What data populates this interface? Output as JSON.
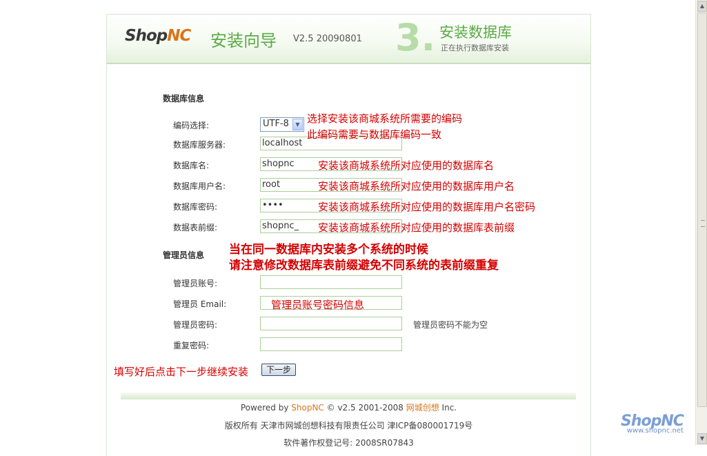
{
  "header": {
    "logo_shop": "Shop",
    "logo_nc": "NC",
    "wizard_title": "安装向导",
    "version": "V2.5 20090801",
    "step_number": "3.",
    "step_title": "安装数据库",
    "step_subtitle": "正在执行数据库安装"
  },
  "db_section": {
    "title": "数据库信息",
    "encoding_label": "编码选择:",
    "encoding_value": "UTF-8",
    "server_label": "数据库服务器:",
    "server_value": "localhost",
    "name_label": "数据库名:",
    "name_value": "shopnc",
    "user_label": "数据库用户名:",
    "user_value": "root",
    "password_label": "数据库密码:",
    "password_value": "••••",
    "prefix_label": "数据表前缀:",
    "prefix_value": "shopnc_"
  },
  "admin_section": {
    "title": "管理员信息",
    "account_label": "管理员账号:",
    "email_label": "管理员 Email:",
    "password_label": "管理员密码:",
    "repeat_label": "重复密码:",
    "password_hint": "管理员密码不能为空"
  },
  "annotations": {
    "encoding_1": "选择安装该商城系统所需要的编码",
    "encoding_2": "此编码需要与数据库编码一致",
    "db_name": "安装该商城系统所对应使用的数据库名",
    "db_user": "安装该商城系统所对应使用的数据库用户名",
    "db_password": "安装该商城系统所对应使用的数据库用户名密码",
    "db_prefix": "安装该商城系统所对应使用的数据库表前缀",
    "warning_1": "当在同一数据库内安装多个系统的时候",
    "warning_2": "请注意修改数据库表前缀避免不同系统的表前缀重复",
    "admin": "管理员账号密码信息",
    "next_step": "填写好后点击下一步继续安装"
  },
  "next_button_label": "下一步",
  "footer": {
    "powered_prefix": "Powered by",
    "powered_brand": "ShopNC",
    "powered_mid": "© v2.5 2001-2008",
    "powered_company": "网城创想",
    "powered_suffix": "Inc.",
    "copyright": "版权所有  天津市网城创想科技有限责任公司  津ICP备080001719号",
    "software_reg": "软件著作权登记号: 2008SR07843"
  },
  "watermark": {
    "brand": "ShopNC",
    "url": "www.shopnc.net"
  },
  "colors": {
    "accent_green": "#5aaa46",
    "annotation_red": "#d40000",
    "brand_orange": "#d8761b"
  }
}
